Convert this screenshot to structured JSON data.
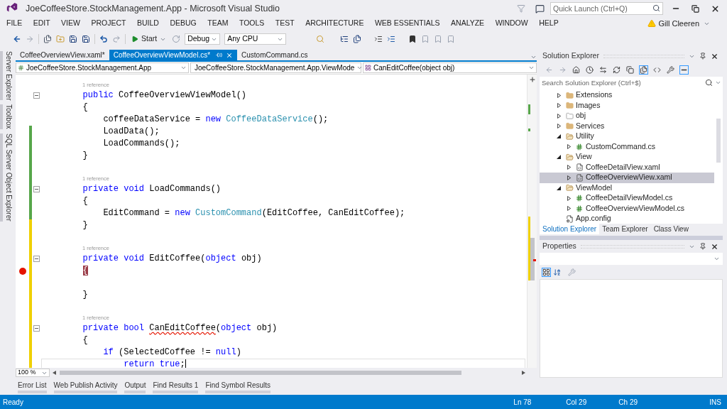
{
  "window": {
    "title": "JoeCoffeeStore.StockManagement.App - Microsoft Visual Studio",
    "quick_launch": {
      "placeholder": "Quick Launch (Ctrl+Q)"
    },
    "user": "Gill Cleeren"
  },
  "menu": [
    "FILE",
    "EDIT",
    "VIEW",
    "PROJECT",
    "BUILD",
    "DEBUG",
    "TEAM",
    "TOOLS",
    "TEST",
    "ARCHITECTURE",
    "WEB ESSENTIALS",
    "ANALYZE",
    "WINDOW",
    "HELP"
  ],
  "toolbar": {
    "start": "Start",
    "configuration": "Debug",
    "platform": "Any CPU"
  },
  "side_tabs": [
    "Server Explorer",
    "Toolbox",
    "SQL Server Object Explorer"
  ],
  "document_tabs": [
    {
      "label": "CoffeeOverviewView.xaml*",
      "selected": false
    },
    {
      "label": "CoffeeOverviewViewModel.cs*",
      "selected": true
    },
    {
      "label": "CustomCommand.cs",
      "selected": false
    }
  ],
  "navigation": {
    "project": "JoeCoffeeStore.StockManagement.App",
    "type": "JoeCoffeeStore.StockManagement.App.ViewMode",
    "member": "CanEditCoffee(object obj)"
  },
  "code": {
    "lines": [
      {
        "kind": "reference",
        "text": "1 reference",
        "modified": false
      },
      {
        "kind": "code",
        "modified": false,
        "fold": true,
        "breakpoint": false,
        "current": false,
        "tokens": [
          {
            "text": "        public",
            "kind": "keyword"
          },
          {
            "text": " CoffeeOverviewViewModel()",
            "kind": "plain"
          }
        ]
      },
      {
        "kind": "code",
        "modified": false,
        "fold": false,
        "breakpoint": false,
        "current": false,
        "tokens": [
          {
            "text": "        {",
            "kind": "plain"
          }
        ]
      },
      {
        "kind": "code",
        "modified": false,
        "fold": false,
        "breakpoint": false,
        "current": false,
        "tokens": [
          {
            "text": "            coffeeDataService = ",
            "kind": "plain"
          },
          {
            "text": "new ",
            "kind": "keyword"
          },
          {
            "text": "CoffeeDataService",
            "kind": "type"
          },
          {
            "text": "();",
            "kind": "plain"
          }
        ]
      },
      {
        "kind": "code",
        "modified": true,
        "saved": true,
        "fold": false,
        "breakpoint": false,
        "current": false,
        "tokens": [
          {
            "text": "            LoadData();",
            "kind": "plain"
          }
        ]
      },
      {
        "kind": "code",
        "modified": true,
        "saved": true,
        "fold": false,
        "breakpoint": false,
        "current": false,
        "tokens": [
          {
            "text": "            LoadCommands();",
            "kind": "plain"
          }
        ]
      },
      {
        "kind": "code",
        "modified": true,
        "saved": true,
        "fold": false,
        "breakpoint": false,
        "current": false,
        "tokens": [
          {
            "text": "        }",
            "kind": "plain"
          }
        ]
      },
      {
        "kind": "blank",
        "modified": true,
        "saved": true
      },
      {
        "kind": "reference",
        "text": "1 reference",
        "modified": true,
        "saved": true
      },
      {
        "kind": "code",
        "modified": true,
        "saved": true,
        "fold": true,
        "breakpoint": false,
        "current": false,
        "tokens": [
          {
            "text": "        private void",
            "kind": "keyword"
          },
          {
            "text": " LoadCommands()",
            "kind": "plain"
          }
        ]
      },
      {
        "kind": "code",
        "modified": true,
        "saved": true,
        "fold": false,
        "breakpoint": false,
        "current": false,
        "tokens": [
          {
            "text": "        {",
            "kind": "plain"
          }
        ]
      },
      {
        "kind": "code",
        "modified": true,
        "saved": true,
        "fold": false,
        "breakpoint": false,
        "current": false,
        "tokens": [
          {
            "text": "            EditCommand = ",
            "kind": "plain"
          },
          {
            "text": "new ",
            "kind": "keyword"
          },
          {
            "text": "CustomCommand",
            "kind": "type"
          },
          {
            "text": "(EditCoffee, CanEditCoffee);",
            "kind": "plain"
          }
        ]
      },
      {
        "kind": "code",
        "modified": true,
        "saved": false,
        "fold": false,
        "breakpoint": false,
        "current": false,
        "tokens": [
          {
            "text": "        }",
            "kind": "plain"
          }
        ]
      },
      {
        "kind": "blank",
        "modified": true,
        "saved": false
      },
      {
        "kind": "reference",
        "text": "1 reference",
        "modified": true,
        "saved": false
      },
      {
        "kind": "code",
        "modified": true,
        "saved": false,
        "fold": true,
        "breakpoint": false,
        "current": false,
        "tokens": [
          {
            "text": "        private void",
            "kind": "keyword"
          },
          {
            "text": " EditCoffee(",
            "kind": "plain"
          },
          {
            "text": "object",
            "kind": "keyword"
          },
          {
            "text": " obj)",
            "kind": "plain"
          }
        ]
      },
      {
        "kind": "code",
        "modified": true,
        "saved": false,
        "fold": false,
        "breakpoint": true,
        "current": false,
        "tokens": [
          {
            "text": "        {",
            "kind": "breakpoint"
          }
        ]
      },
      {
        "kind": "blank",
        "modified": true,
        "saved": false
      },
      {
        "kind": "code",
        "modified": true,
        "saved": false,
        "fold": false,
        "breakpoint": false,
        "current": false,
        "tokens": [
          {
            "text": "        }",
            "kind": "plain"
          }
        ]
      },
      {
        "kind": "blank",
        "modified": true,
        "saved": false
      },
      {
        "kind": "reference",
        "text": "1 reference",
        "modified": true,
        "saved": false
      },
      {
        "kind": "code",
        "modified": true,
        "saved": false,
        "fold": true,
        "breakpoint": false,
        "current": false,
        "tokens": [
          {
            "text": "        private bool",
            "kind": "keyword"
          },
          {
            "text": " CanEditCoffee",
            "kind": "error"
          },
          {
            "text": "(",
            "kind": "plain"
          },
          {
            "text": "object",
            "kind": "keyword"
          },
          {
            "text": " obj)",
            "kind": "plain"
          }
        ]
      },
      {
        "kind": "code",
        "modified": true,
        "saved": false,
        "fold": false,
        "breakpoint": false,
        "current": false,
        "tokens": [
          {
            "text": "        {",
            "kind": "plain"
          }
        ]
      },
      {
        "kind": "code",
        "modified": true,
        "saved": false,
        "fold": false,
        "breakpoint": false,
        "current": false,
        "tokens": [
          {
            "text": "            if",
            "kind": "keyword"
          },
          {
            "text": " (SelectedCoffee != ",
            "kind": "plain"
          },
          {
            "text": "null",
            "kind": "keyword"
          },
          {
            "text": ")",
            "kind": "plain"
          }
        ]
      },
      {
        "kind": "code",
        "modified": true,
        "saved": false,
        "fold": false,
        "breakpoint": false,
        "current": true,
        "tokens": [
          {
            "text": "                return true",
            "kind": "keyword"
          },
          {
            "text": ";",
            "kind": "plain"
          }
        ]
      }
    ]
  },
  "zoom": "100 %",
  "solution_explorer": {
    "title": "Solution Explorer",
    "search": {
      "placeholder": "Search Solution Explorer (Ctrl+$)"
    },
    "items": [
      {
        "label": "Extensions",
        "kind": "folder",
        "expanded": false,
        "selected": false
      },
      {
        "label": "Images",
        "kind": "folder",
        "expanded": false,
        "selected": false
      },
      {
        "label": "obj",
        "kind": "excluded",
        "expanded": false,
        "selected": false
      },
      {
        "label": "Services",
        "kind": "folder",
        "expanded": false,
        "selected": false
      },
      {
        "label": "Utility",
        "kind": "folder",
        "expanded": true,
        "selected": false,
        "children": [
          {
            "label": "CustomCommand.cs",
            "kind": "csharp",
            "expanded": false,
            "selected": false
          }
        ]
      },
      {
        "label": "View",
        "kind": "folder",
        "expanded": true,
        "selected": false,
        "children": [
          {
            "label": "CoffeeDetailView.xaml",
            "kind": "xaml",
            "expanded": false,
            "selected": false
          },
          {
            "label": "CoffeeOverviewView.xaml",
            "kind": "xaml",
            "expanded": false,
            "selected": true
          }
        ]
      },
      {
        "label": "ViewModel",
        "kind": "folder",
        "expanded": true,
        "selected": false,
        "children": [
          {
            "label": "CoffeeDetailViewModel.cs",
            "kind": "csharp",
            "expanded": false,
            "selected": false
          },
          {
            "label": "CoffeeOverviewViewModel.cs",
            "kind": "csharp",
            "expanded": false,
            "selected": false
          }
        ]
      },
      {
        "label": "App.config",
        "kind": "config",
        "selected": false
      }
    ],
    "tabs": [
      {
        "label": "Solution Explorer",
        "selected": true
      },
      {
        "label": "Team Explorer",
        "selected": false
      },
      {
        "label": "Class View",
        "selected": false
      }
    ]
  },
  "properties": {
    "title": "Properties"
  },
  "tool_tabs": [
    "Error List",
    "Web Publish Activity",
    "Output",
    "Find Results 1",
    "Find Symbol Results"
  ],
  "status_bar": {
    "text": "Ready",
    "line": "Ln 78",
    "column": "Col 29",
    "char": "Ch 29",
    "mode": "INS"
  }
}
